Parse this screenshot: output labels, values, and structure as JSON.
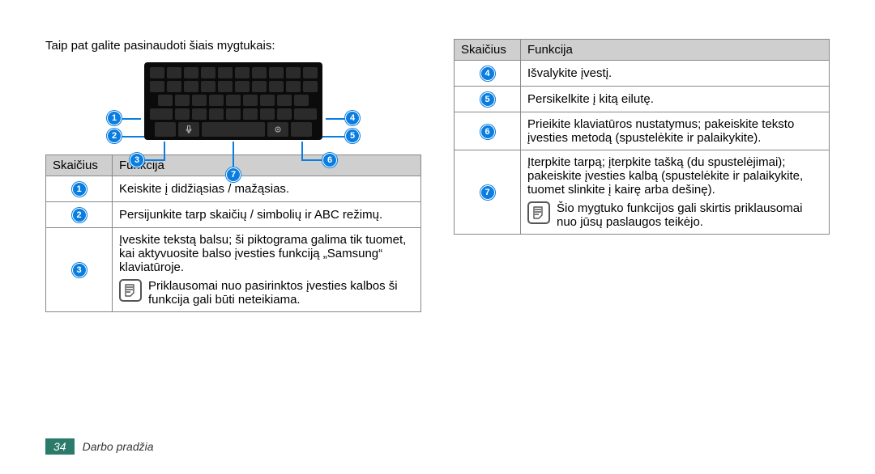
{
  "intro": "Taip pat galite pasinaudoti šiais mygtukais:",
  "table_header": {
    "number": "Skaičius",
    "function": "Funkcija"
  },
  "left_rows": [
    {
      "n": "1",
      "text": "Keiskite į didžiąsias / mažąsias."
    },
    {
      "n": "2",
      "text": "Persijunkite tarp skaičių / simbolių ir ABC režimų."
    },
    {
      "n": "3",
      "text": "Įveskite tekstą balsu; ši piktograma galima tik tuomet, kai aktyvuosite balso įvesties funkciją „Samsung“ klaviatūroje.",
      "note": "Priklausomai nuo pasirinktos įvesties kalbos ši funkcija gali būti neteikiama."
    }
  ],
  "right_rows": [
    {
      "n": "4",
      "text": "Išvalykite įvestį."
    },
    {
      "n": "5",
      "text": "Persikelkite į kitą eilutę."
    },
    {
      "n": "6",
      "text": "Prieikite klaviatūros nustatymus; pakeiskite teksto įvesties metodą (spustelėkite ir palaikykite)."
    },
    {
      "n": "7",
      "text": "Įterpkite tarpą; įterpkite tašką (du spustelėjimai); pakeiskite įvesties kalbą (spustelėkite ir palaikykite, tuomet slinkite į kairę arba dešinę).",
      "note": "Šio mygtuko funkcijos gali skirtis priklausomai nuo jūsų paslaugos teikėjo."
    }
  ],
  "footer": {
    "page": "34",
    "section": "Darbo pradžia"
  },
  "callouts": [
    "1",
    "2",
    "3",
    "4",
    "5",
    "6",
    "7"
  ]
}
